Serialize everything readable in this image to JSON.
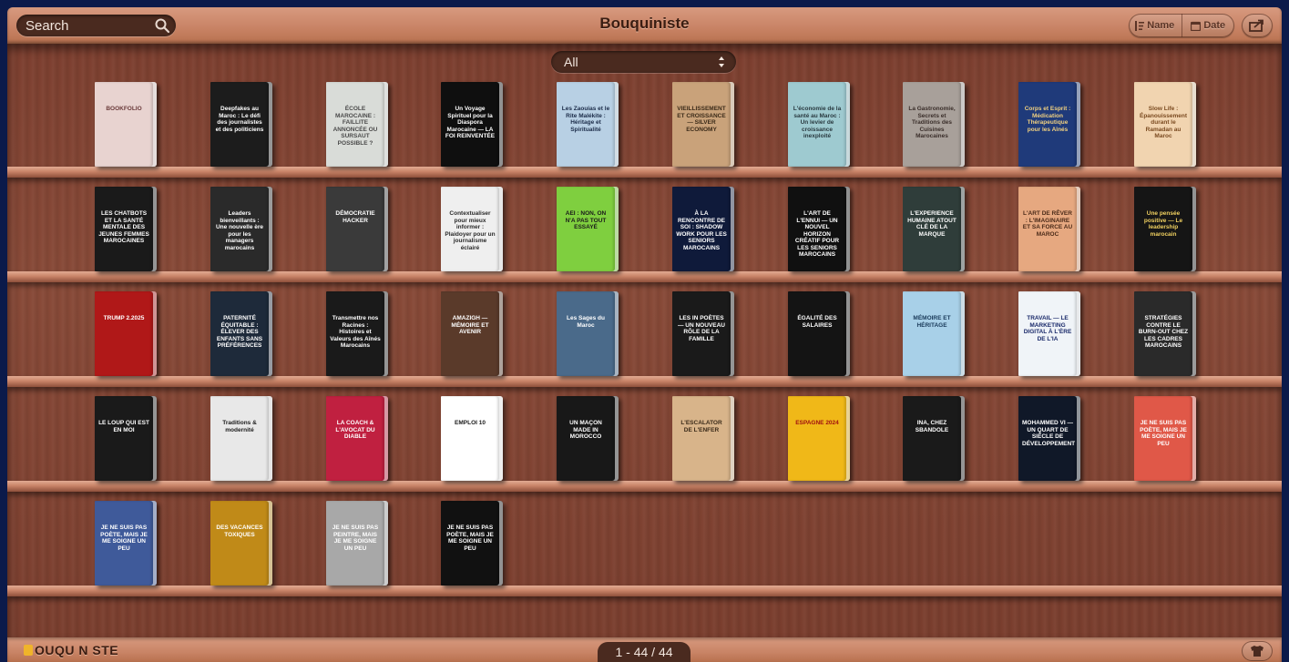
{
  "header": {
    "search_placeholder": "Search",
    "title": "Bouquiniste",
    "sort_name": "Name",
    "sort_date": "Date"
  },
  "filter": {
    "selected": "All"
  },
  "footer": {
    "logo": "OUQU N STE",
    "pagination": "1 - 44 / 44"
  },
  "colors": {
    "wood_light": "#d79a7f",
    "wood_dark": "#7c3f2f",
    "control_dark": "#4a2a1f",
    "background": "#0b1a4a"
  },
  "books": [
    {
      "title": "BOOKFOLIO",
      "bg": "#e8d3d0",
      "fg": "#6a3a3a"
    },
    {
      "title": "Deepfakes au Maroc : Le défi des journalistes et des politiciens",
      "bg": "#1c1c1c",
      "fg": "#ffffff"
    },
    {
      "title": "ÉCOLE MAROCAINE : FAILLITE ANNONCÉE OU SURSAUT POSSIBLE ?",
      "bg": "#d9dcd8",
      "fg": "#4a4a4a"
    },
    {
      "title": "Un Voyage Spirituel pour la Diaspora Marocaine — LA FOI REINVENTÉE",
      "bg": "#0f0f0f",
      "fg": "#ffffff"
    },
    {
      "title": "Les Zaouias et le Rite Malékite : Héritage et Spiritualité",
      "bg": "#b8d0e4",
      "fg": "#1b2b48"
    },
    {
      "title": "VIEILLISSEMENT ET CROISSANCE — SILVER ECONOMY",
      "bg": "#c9a27a",
      "fg": "#3a2a18"
    },
    {
      "title": "L'économie de la santé au Maroc : Un levier de croissance inexploité",
      "bg": "#9ecad0",
      "fg": "#2a3a40"
    },
    {
      "title": "La Gastronomie, Secrets et Traditions des Cuisines Marocaines",
      "bg": "#a8a09a",
      "fg": "#3a2e2a"
    },
    {
      "title": "Corps et Esprit : Médication Thérapeutique pour les Aînés",
      "bg": "#1f3a7a",
      "fg": "#f0d080"
    },
    {
      "title": "Slow Life : Épanouissement durant le Ramadan au Maroc",
      "bg": "#f1d4b0",
      "fg": "#7a4a20"
    },
    {
      "title": "LES CHATBOTS ET LA SANTÉ MENTALE DES JEUNES FEMMES MAROCAINES",
      "bg": "#1a1a1a",
      "fg": "#ffffff"
    },
    {
      "title": "Leaders bienveillants : Une nouvelle ère pour les managers marocains",
      "bg": "#2a2a2a",
      "fg": "#ffffff"
    },
    {
      "title": "DÉMOCRATIE HACKER",
      "bg": "#3a3a3a",
      "fg": "#ffffff"
    },
    {
      "title": "Contextualiser pour mieux informer : Plaidoyer pour un journalisme éclairé",
      "bg": "#efefef",
      "fg": "#2a2a2a"
    },
    {
      "title": "AEI : NON, ON N'A PAS TOUT ESSAYÉ",
      "bg": "#7fcf3f",
      "fg": "#1a1a1a"
    },
    {
      "title": "À LA RENCONTRE DE SOI : SHADOW WORK POUR LES SENIORS MAROCAINS",
      "bg": "#0f1a3a",
      "fg": "#ffffff"
    },
    {
      "title": "L'ART DE L'ENNUI — UN NOUVEL HORIZON CRÉATIF POUR LES SENIORS MAROCAINS",
      "bg": "#101010",
      "fg": "#ffffff"
    },
    {
      "title": "L'EXPERIENCE HUMAINE ATOUT CLÉ DE LA MARQUE",
      "bg": "#2f3d3a",
      "fg": "#ffffff"
    },
    {
      "title": "L'ART DE RÊVER : L'IMAGINAIRE ET SA FORCE AU MAROC",
      "bg": "#e6a880",
      "fg": "#4a2a18"
    },
    {
      "title": "Une pensée positive — Le leadership marocain",
      "bg": "#151515",
      "fg": "#f0d060"
    },
    {
      "title": "TRUMP 2.2025",
      "bg": "#b01818",
      "fg": "#ffffff"
    },
    {
      "title": "PATERNITÉ ÉQUITABLE : ÉLEVER DES ENFANTS SANS PRÉFÉRENCES",
      "bg": "#1e2a3a",
      "fg": "#ffffff"
    },
    {
      "title": "Transmettre nos Racines : Histoires et Valeurs des Aînés Marocains",
      "bg": "#1a1a1a",
      "fg": "#ffffff"
    },
    {
      "title": "AMAZIGH — MÉMOIRE ET AVENIR",
      "bg": "#5a3a2a",
      "fg": "#ffffff"
    },
    {
      "title": "Les Sages du Maroc",
      "bg": "#4a6a8a",
      "fg": "#ffffff"
    },
    {
      "title": "LES IN POÈTES — UN NOUVEAU RÔLE DE LA FAMILLE",
      "bg": "#1a1a1a",
      "fg": "#ffffff"
    },
    {
      "title": "ÉGALITÉ DES SALAIRES",
      "bg": "#141414",
      "fg": "#ffffff"
    },
    {
      "title": "MÉMOIRE ET HÉRITAGE",
      "bg": "#a8d0e8",
      "fg": "#1a3a5a"
    },
    {
      "title": "TRAVAIL — LE MARKETING DIGITAL À L'ÈRE DE L'IA",
      "bg": "#f0f4f8",
      "fg": "#1a2a6a"
    },
    {
      "title": "STRATÉGIES CONTRE LE BURN-OUT CHEZ LES CADRES MAROCAINS",
      "bg": "#2a2a2a",
      "fg": "#ffffff"
    },
    {
      "title": "LE LOUP QUI EST EN MOI",
      "bg": "#1a1a1a",
      "fg": "#ffffff"
    },
    {
      "title": "Traditions & modernité",
      "bg": "#e8e8e8",
      "fg": "#1a1a1a"
    },
    {
      "title": "LA COACH & L'AVOCAT DU DIABLE",
      "bg": "#c02040",
      "fg": "#ffffff"
    },
    {
      "title": "EMPLOI 10",
      "bg": "#ffffff",
      "fg": "#1a1a1a"
    },
    {
      "title": "UN MAÇON MADE IN MOROCCO",
      "bg": "#181818",
      "fg": "#ffffff"
    },
    {
      "title": "L'ESCALATOR DE L'ENFER",
      "bg": "#d8b48a",
      "fg": "#3a2a18"
    },
    {
      "title": "ESPAGNE 2024",
      "bg": "#f0b818",
      "fg": "#a01010"
    },
    {
      "title": "INA, CHEZ SBANDOLE",
      "bg": "#1a1a1a",
      "fg": "#ffffff"
    },
    {
      "title": "MOHAMMED VI — UN QUART DE SIÈCLE DE DÉVELOPPEMENT",
      "bg": "#101828",
      "fg": "#ffffff"
    },
    {
      "title": "JE NE SUIS PAS POÈTE, MAIS JE ME SOIGNE UN PEU",
      "bg": "#e05848",
      "fg": "#ffffff"
    },
    {
      "title": "JE NE SUIS PAS POÈTE, MAIS JE ME SOIGNE UN PEU",
      "bg": "#3f5a9a",
      "fg": "#ffffff"
    },
    {
      "title": "DES VACANCES TOXIQUES",
      "bg": "#c08a18",
      "fg": "#ffffff"
    },
    {
      "title": "JE NE SUIS PAS PEINTRE, MAIS JE ME SOIGNE UN PEU",
      "bg": "#a8a8a8",
      "fg": "#ffffff"
    },
    {
      "title": "JE NE SUIS PAS POÈTE, MAIS JE ME SOIGNE UN PEU",
      "bg": "#111111",
      "fg": "#ffffff"
    }
  ]
}
